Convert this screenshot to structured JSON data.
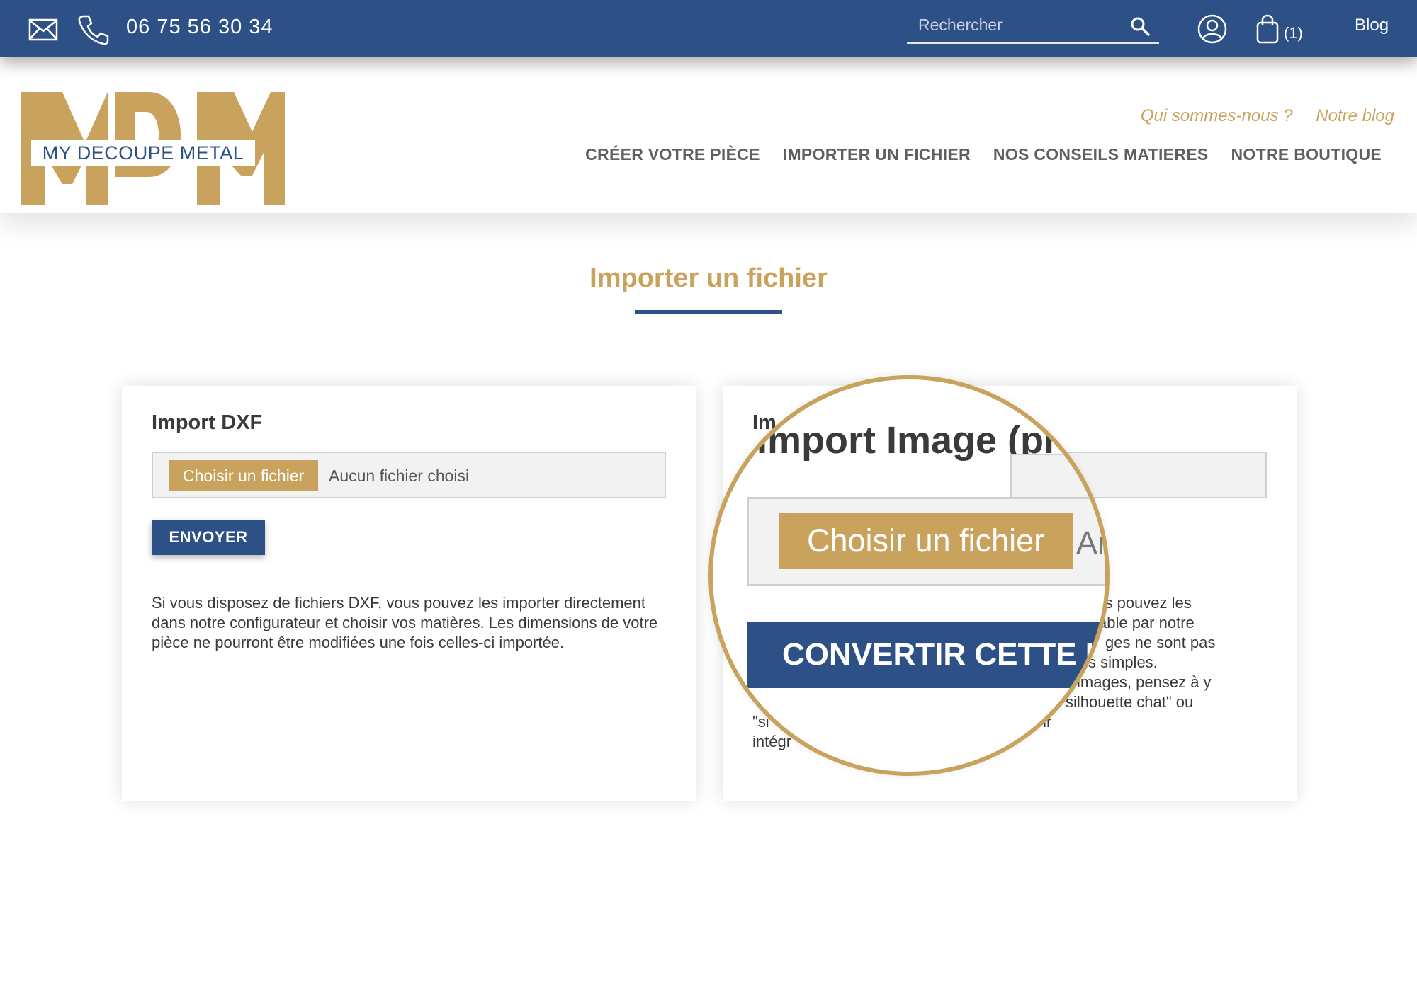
{
  "topbar": {
    "phone": "06 75 56 30 34",
    "search_placeholder": "Rechercher",
    "cart_count": "(1)",
    "blog_label": "Blog"
  },
  "header": {
    "logo_text": "MDM",
    "logo_tagline": "MY DECOUPE METAL",
    "sub_links": [
      "Qui sommes-nous ?",
      "Notre blog"
    ],
    "nav": [
      "CRÉER VOTRE PIÈCE",
      "IMPORTER UN FICHIER",
      "NOS CONSEILS MATIERES",
      "NOTRE BOUTIQUE"
    ]
  },
  "page": {
    "title": "Importer un fichier"
  },
  "card_dxf": {
    "title": "Import DXF",
    "file_button": "Choisir un fichier",
    "file_status": "Aucun fichier choisi",
    "send_button": "ENVOYER",
    "description": "Si vous disposez de fichiers DXF, vous pouvez les importer directement dans notre configurateur et choisir vos matières. Les dimensions de votre pièce ne pourront être modifiées une fois celles-ci importée."
  },
  "card_image": {
    "title": "Import Image (pi",
    "file_button": "Choisir un fichier",
    "file_status": "Ai",
    "convert_button": "CONVERTIR CETTE IM",
    "desc_lines": [
      "vous pouvez les",
      "able par notre",
      "ges ne sont pas",
      "s simples.",
      "images, pensez à y",
      "silhouette chat\" ou",
      "\"si                          us de chance de pouvoir",
      "intégr                                          teur."
    ]
  },
  "colors": {
    "primary_blue": "#2d5087",
    "gold": "#c9a35e"
  }
}
